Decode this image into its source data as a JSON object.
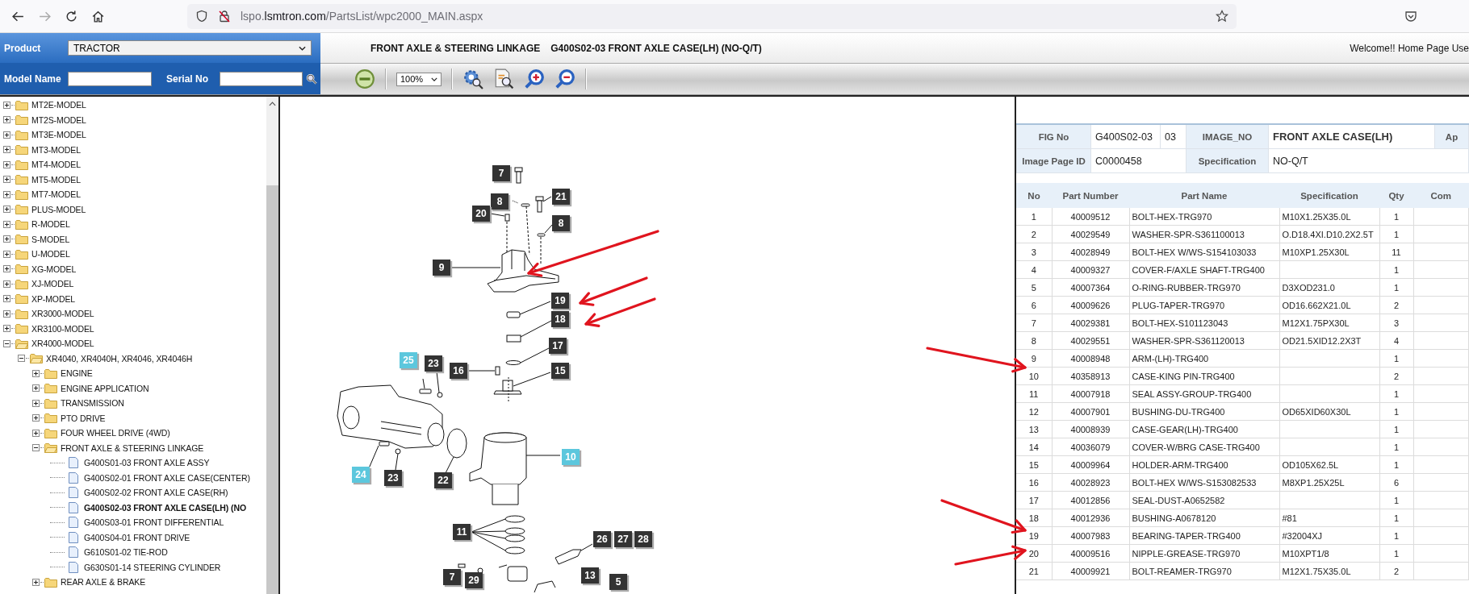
{
  "browser": {
    "url_prefix": "lspo.",
    "url_domain": "lsmtron.com",
    "url_path": "/PartsList/wpc2000_MAIN.aspx"
  },
  "search_panel": {
    "product_label": "Product",
    "product_value": "TRACTOR",
    "model_label": "Model Name",
    "serial_label": "Serial No"
  },
  "header": {
    "category": "FRONT AXLE & STEERING LINKAGE",
    "figure": "G400S02-03 FRONT AXLE CASE(LH) (NO-Q/T)",
    "welcome": "Welcome!! Home Page Use"
  },
  "toolbar": {
    "zoom_value": "100%"
  },
  "tree": [
    {
      "label": "MT2E-MODEL",
      "kind": "folder",
      "expanded": false
    },
    {
      "label": "MT2S-MODEL",
      "kind": "folder",
      "expanded": false
    },
    {
      "label": "MT3E-MODEL",
      "kind": "folder",
      "expanded": false
    },
    {
      "label": "MT3-MODEL",
      "kind": "folder",
      "expanded": false
    },
    {
      "label": "MT4-MODEL",
      "kind": "folder",
      "expanded": false
    },
    {
      "label": "MT5-MODEL",
      "kind": "folder",
      "expanded": false
    },
    {
      "label": "MT7-MODEL",
      "kind": "folder",
      "expanded": false
    },
    {
      "label": "PLUS-MODEL",
      "kind": "folder",
      "expanded": false
    },
    {
      "label": "R-MODEL",
      "kind": "folder",
      "expanded": false
    },
    {
      "label": "S-MODEL",
      "kind": "folder",
      "expanded": false
    },
    {
      "label": "U-MODEL",
      "kind": "folder",
      "expanded": false
    },
    {
      "label": "XG-MODEL",
      "kind": "folder",
      "expanded": false
    },
    {
      "label": "XJ-MODEL",
      "kind": "folder",
      "expanded": false
    },
    {
      "label": "XP-MODEL",
      "kind": "folder",
      "expanded": false
    },
    {
      "label": "XR3000-MODEL",
      "kind": "folder",
      "expanded": false
    },
    {
      "label": "XR3100-MODEL",
      "kind": "folder",
      "expanded": false
    },
    {
      "label": "XR4000-MODEL",
      "kind": "folder",
      "expanded": true,
      "children": [
        {
          "label": "XR4040, XR4040H, XR4046, XR4046H",
          "kind": "folder",
          "expanded": true,
          "children": [
            {
              "label": "ENGINE",
              "kind": "folder",
              "expanded": false
            },
            {
              "label": "ENGINE APPLICATION",
              "kind": "folder",
              "expanded": false
            },
            {
              "label": "TRANSMISSION",
              "kind": "folder",
              "expanded": false
            },
            {
              "label": "PTO DRIVE",
              "kind": "folder",
              "expanded": false
            },
            {
              "label": "FOUR WHEEL DRIVE (4WD)",
              "kind": "folder",
              "expanded": false
            },
            {
              "label": "FRONT AXLE & STEERING LINKAGE",
              "kind": "folder",
              "expanded": true,
              "children": [
                {
                  "label": "G400S01-03 FRONT AXLE ASSY",
                  "kind": "page",
                  "selected": false
                },
                {
                  "label": "G400S02-01 FRONT AXLE CASE(CENTER)",
                  "kind": "page",
                  "selected": false
                },
                {
                  "label": "G400S02-02 FRONT AXLE CASE(RH)",
                  "kind": "page",
                  "selected": false
                },
                {
                  "label": "G400S02-03 FRONT AXLE CASE(LH) (NO",
                  "kind": "page",
                  "selected": true
                },
                {
                  "label": "G400S03-01 FRONT DIFFERENTIAL",
                  "kind": "page",
                  "selected": false
                },
                {
                  "label": "G400S04-01 FRONT DRIVE",
                  "kind": "page",
                  "selected": false
                },
                {
                  "label": "G610S01-02 TIE-ROD",
                  "kind": "page",
                  "selected": false
                },
                {
                  "label": "G630S01-14 STEERING CYLINDER",
                  "kind": "page",
                  "selected": false
                }
              ]
            },
            {
              "label": "REAR AXLE & BRAKE",
              "kind": "folder",
              "expanded": false
            }
          ]
        }
      ]
    }
  ],
  "callouts": [
    {
      "label": "7",
      "highlighted": false
    },
    {
      "label": "8",
      "highlighted": false
    },
    {
      "label": "21",
      "highlighted": false
    },
    {
      "label": "20",
      "highlighted": false
    },
    {
      "label": "8",
      "highlighted": false
    },
    {
      "label": "9",
      "highlighted": false
    },
    {
      "label": "19",
      "highlighted": false
    },
    {
      "label": "18",
      "highlighted": false
    },
    {
      "label": "17",
      "highlighted": false
    },
    {
      "label": "16",
      "highlighted": false
    },
    {
      "label": "15",
      "highlighted": false
    },
    {
      "label": "25",
      "highlighted": true
    },
    {
      "label": "23",
      "highlighted": false
    },
    {
      "label": "10",
      "highlighted": true
    },
    {
      "label": "24",
      "highlighted": true
    },
    {
      "label": "23",
      "highlighted": false
    },
    {
      "label": "22",
      "highlighted": false
    },
    {
      "label": "11",
      "highlighted": false
    },
    {
      "label": "26",
      "highlighted": false
    },
    {
      "label": "27",
      "highlighted": false
    },
    {
      "label": "28",
      "highlighted": false
    },
    {
      "label": "7",
      "highlighted": false
    },
    {
      "label": "29",
      "highlighted": false
    },
    {
      "label": "13",
      "highlighted": false
    },
    {
      "label": "5",
      "highlighted": false
    }
  ],
  "figure_info": {
    "fig_no_label": "FIG No",
    "fig_no": "G400S02-03",
    "fig_sub": "03",
    "image_no_label": "IMAGE_NO",
    "image_no": "FRONT AXLE CASE(LH)",
    "column_6": "Ap",
    "page_id_label": "Image Page ID",
    "page_id": "C0000458",
    "spec_label": "Specification",
    "spec": "NO-Q/T"
  },
  "parts_table": {
    "columns": [
      "No",
      "Part Number",
      "Part Name",
      "Specification",
      "Qty",
      "Com"
    ],
    "rows": [
      [
        "1",
        "40009512",
        "BOLT-HEX-TRG970",
        "M10X1.25X35.0L",
        "1"
      ],
      [
        "2",
        "40029549",
        "WASHER-SPR-S361100013",
        "O.D18.4XI.D10.2X2.5T",
        "1"
      ],
      [
        "3",
        "40028949",
        "BOLT-HEX W/WS-S154103033",
        "M10XP1.25X30L",
        "11"
      ],
      [
        "4",
        "40009327",
        "COVER-F/AXLE SHAFT-TRG400",
        "",
        "1"
      ],
      [
        "5",
        "40007364",
        "O-RING-RUBBER-TRG970",
        "D3XOD231.0",
        "1"
      ],
      [
        "6",
        "40009626",
        "PLUG-TAPER-TRG970",
        "OD16.662X21.0L",
        "2"
      ],
      [
        "7",
        "40029381",
        "BOLT-HEX-S101123043",
        "M12X1.75PX30L",
        "3"
      ],
      [
        "8",
        "40029551",
        "WASHER-SPR-S361120013",
        "OD21.5XID12.2X3T",
        "4"
      ],
      [
        "9",
        "40008948",
        "ARM-(LH)-TRG400",
        "",
        "1"
      ],
      [
        "10",
        "40358913",
        "CASE-KING PIN-TRG400",
        "",
        "2"
      ],
      [
        "11",
        "40007918",
        "SEAL ASSY-GROUP-TRG400",
        "",
        "1"
      ],
      [
        "12",
        "40007901",
        "BUSHING-DU-TRG400",
        "OD65XID60X30L",
        "1"
      ],
      [
        "13",
        "40008939",
        "CASE-GEAR(LH)-TRG400",
        "",
        "1"
      ],
      [
        "14",
        "40036079",
        "COVER-W/BRG CASE-TRG400",
        "",
        "1"
      ],
      [
        "15",
        "40009964",
        "HOLDER-ARM-TRG400",
        "OD105X62.5L",
        "1"
      ],
      [
        "16",
        "40028923",
        "BOLT-HEX W/WS-S153082533",
        "M8XP1.25X25L",
        "6"
      ],
      [
        "17",
        "40012856",
        "SEAL-DUST-A0652582",
        "",
        "1"
      ],
      [
        "18",
        "40012936",
        "BUSHING-A0678120",
        "#81",
        "1"
      ],
      [
        "19",
        "40007983",
        "BEARING-TAPER-TRG400",
        "#32004XJ",
        "1"
      ],
      [
        "20",
        "40009516",
        "NIPPLE-GREASE-TRG970",
        "M10XPT1/8",
        "1"
      ],
      [
        "21",
        "40009921",
        "BOLT-REAMER-TRG970",
        "M12X1.75X35.0L",
        "2"
      ]
    ]
  }
}
